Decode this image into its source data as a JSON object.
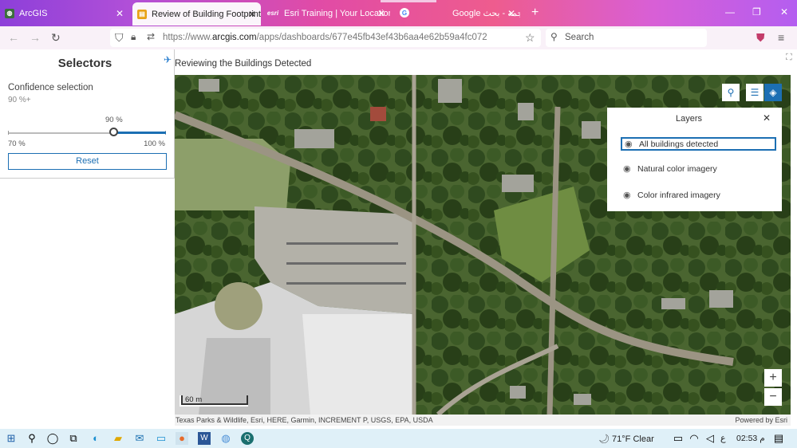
{
  "browser": {
    "tabs": [
      {
        "title": "ArcGIS",
        "icon": "arcgis-globe-icon",
        "active": false
      },
      {
        "title": "Review of Building Footprint re",
        "icon": "dashboard-icon",
        "active": true
      },
      {
        "title": "Esri Training | Your Location for",
        "icon": "esri-logo-icon",
        "active": false
      },
      {
        "title": "Google ترجمة - بحث",
        "icon": "google-icon",
        "active": false
      }
    ],
    "url_prefix": "https://www.",
    "url_domain": "arcgis.com",
    "url_path": "/apps/dashboards/677e45fb43ef43b6aa4e62b59a4fc072",
    "search_placeholder": "Search"
  },
  "selectors": {
    "title": "Selectors",
    "confidence_label": "Confidence selection",
    "confidence_value": "90 %+",
    "slider_thumb_label": "90 %",
    "slider_min_label": "70 %",
    "slider_max_label": "100 %",
    "slider_min": 70,
    "slider_max": 100,
    "slider_value": 90,
    "reset_label": "Reset"
  },
  "map": {
    "title": "Reviewing the Buildings Detected",
    "scale_label": "60 m",
    "attribution": "Texas Parks & Wildlife, Esri, HERE, Garmin, INCREMENT P, USGS, EPA, USDA",
    "powered_by": "Powered by Esri"
  },
  "layers": {
    "title": "Layers",
    "items": [
      {
        "label": "All buildings detected",
        "selected": true
      },
      {
        "label": "Natural color imagery",
        "selected": false
      },
      {
        "label": "Color infrared imagery",
        "selected": false
      }
    ]
  },
  "taskbar": {
    "temperature": "71°F",
    "weather": "Clear",
    "language": "ع",
    "time": "02:53 م"
  },
  "colors": {
    "accent": "#1c6fb3",
    "tabbar_start": "#8d3fd9",
    "tabbar_mid": "#e14ba6"
  }
}
